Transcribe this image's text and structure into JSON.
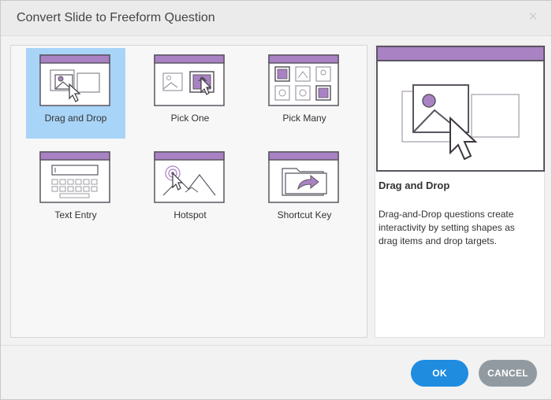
{
  "dialog": {
    "title": "Convert Slide to Freeform Question",
    "close_icon": "close-icon"
  },
  "question_types": [
    {
      "label": "Drag and Drop",
      "icon": "drag-and-drop-icon",
      "selected": true
    },
    {
      "label": "Pick One",
      "icon": "pick-one-icon",
      "selected": false
    },
    {
      "label": "Pick Many",
      "icon": "pick-many-icon",
      "selected": false
    },
    {
      "label": "Text Entry",
      "icon": "text-entry-icon",
      "selected": false
    },
    {
      "label": "Hotspot",
      "icon": "hotspot-icon",
      "selected": false
    },
    {
      "label": "Shortcut Key",
      "icon": "shortcut-key-icon",
      "selected": false
    }
  ],
  "preview": {
    "title": "Drag and Drop",
    "description": "Drag-and-Drop questions create interactivity by setting shapes as drag items and drop targets."
  },
  "buttons": {
    "ok": "OK",
    "cancel": "CANCEL"
  },
  "colors": {
    "accent_purple": "#a982c4",
    "selection_blue": "#a8d4f7",
    "ok_blue": "#1f8ce0",
    "cancel_gray": "#929aa1"
  }
}
